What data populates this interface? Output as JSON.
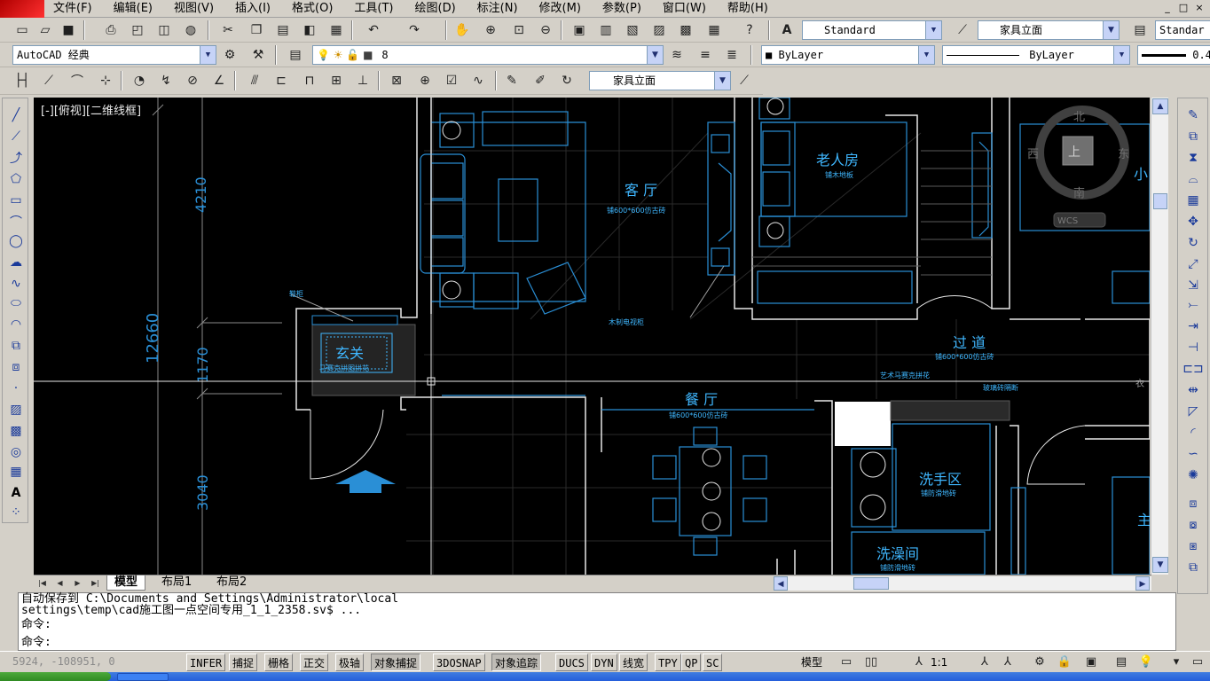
{
  "menu": {
    "items": [
      "文件(F)",
      "编辑(E)",
      "视图(V)",
      "插入(I)",
      "格式(O)",
      "工具(T)",
      "绘图(D)",
      "标注(N)",
      "修改(M)",
      "参数(P)",
      "窗口(W)",
      "帮助(H)"
    ],
    "window_controls": [
      "_",
      "□",
      "×"
    ]
  },
  "toolbar": {
    "text_style": "Standard",
    "dim_style": "家具立面",
    "table_style": "Standar",
    "workspace": "AutoCAD 经典",
    "layer": "8",
    "color": "ByLayer",
    "linetype": "ByLayer",
    "lineweight_value": "0.4",
    "dim_style_combo": "家具立面"
  },
  "viewport": {
    "label": "[-][俯视][二维线框]"
  },
  "viewcube": {
    "north": "北",
    "south": "南",
    "east": "东",
    "west": "西",
    "top": "上",
    "wcs": "WCS"
  },
  "drawing": {
    "dimensions": {
      "d_4210": "4210",
      "d_12660": "12660",
      "d_1170": "1170",
      "d_3040": "3040"
    },
    "rooms": {
      "living": "客 厅",
      "living_sub": "铺600*600仿古砖",
      "elder_room": "老人房",
      "elder_sub": "铺木地板",
      "foyer": "玄关",
      "foyer_sub": "马赛克拼图拼花",
      "corridor": "过 道",
      "corridor_sub": "铺600*600仿古砖",
      "dining": "餐 厅",
      "dining_sub": "铺600*600仿古砖",
      "wash": "洗手区",
      "wash_sub": "铺防滑地砖",
      "bath": "洗澡间",
      "bath_sub": "铺防滑地砖",
      "small_room": "小",
      "master_room": "主"
    },
    "notes": {
      "shoe_cabinet": "鞋柜",
      "tv_cabinet": "木制电视柜",
      "mosaic": "艺术马赛克拼花",
      "glass_brick": "玻璃砖隔断",
      "right_partial": "衣"
    }
  },
  "tabs": {
    "nav": [
      "|◀",
      "◀",
      "▶",
      "▶|"
    ],
    "model": "模型",
    "layout1": "布局1",
    "layout2": "布局2"
  },
  "command": {
    "line1": "自动保存到 C:\\Documents and Settings\\Administrator\\local",
    "line2": "settings\\temp\\cad施工图一点空间专用_1_1_2358.sv$ ...",
    "line3": "命令:",
    "prompt": "命令:"
  },
  "status": {
    "coords": "5924, -108951, 0",
    "toggles": [
      "INFER",
      "捕捉",
      "栅格",
      "正交",
      "极轴",
      "对象捕捉",
      "3DOSNAP",
      "对象追踪",
      "DUCS",
      "DYN",
      "线宽",
      "TPY",
      "QP",
      "SC"
    ],
    "model_space": "模型",
    "annotation_scale": "1:1"
  },
  "colors": {
    "cad_background": "#000000",
    "cad_line": "#2a8fd6",
    "cad_cyan": "#3fb7ff",
    "cad_white": "#e8e8e8",
    "cad_grey": "#5a5a5a",
    "panel": "#d4d0c8"
  }
}
